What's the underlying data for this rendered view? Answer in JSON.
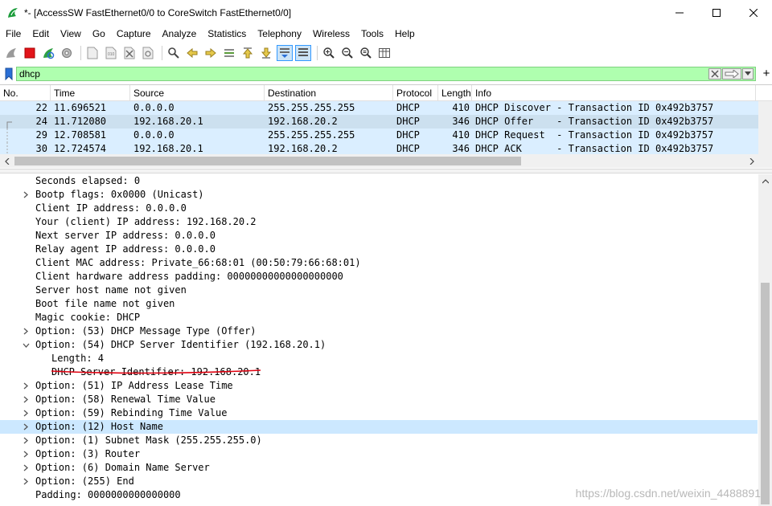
{
  "window": {
    "title": "*- [AccessSW FastEthernet0/0 to CoreSwitch FastEthernet0/0]",
    "minimize": "—",
    "maximize": "☐",
    "close": "✕"
  },
  "menu": [
    "File",
    "Edit",
    "View",
    "Go",
    "Capture",
    "Analyze",
    "Statistics",
    "Telephony",
    "Wireless",
    "Tools",
    "Help"
  ],
  "filter": {
    "value": "dhcp",
    "add": "+"
  },
  "packet_list": {
    "columns": [
      "No.",
      "Time",
      "Source",
      "Destination",
      "Protocol",
      "Length",
      "Info"
    ],
    "rows": [
      {
        "no": "22",
        "time": "11.696521",
        "src": "0.0.0.0",
        "dst": "255.255.255.255",
        "proto": "DHCP",
        "len": "410",
        "info": "DHCP Discover - Transaction ID 0x492b3757"
      },
      {
        "no": "24",
        "time": "11.712080",
        "src": "192.168.20.1",
        "dst": "192.168.20.2",
        "proto": "DHCP",
        "len": "346",
        "info": "DHCP Offer    - Transaction ID 0x492b3757"
      },
      {
        "no": "29",
        "time": "12.708581",
        "src": "0.0.0.0",
        "dst": "255.255.255.255",
        "proto": "DHCP",
        "len": "410",
        "info": "DHCP Request  - Transaction ID 0x492b3757"
      },
      {
        "no": "30",
        "time": "12.724574",
        "src": "192.168.20.1",
        "dst": "192.168.20.2",
        "proto": "DHCP",
        "len": "346",
        "info": "DHCP ACK      - Transaction ID 0x492b3757"
      }
    ]
  },
  "details": [
    {
      "text": "Seconds elapsed: 0",
      "indent": 0,
      "arrow": "none"
    },
    {
      "text": "Bootp flags: 0x0000 (Unicast)",
      "indent": 0,
      "arrow": "right"
    },
    {
      "text": "Client IP address: 0.0.0.0",
      "indent": 0,
      "arrow": "none"
    },
    {
      "text": "Your (client) IP address: 192.168.20.2",
      "indent": 0,
      "arrow": "none"
    },
    {
      "text": "Next server IP address: 0.0.0.0",
      "indent": 0,
      "arrow": "none"
    },
    {
      "text": "Relay agent IP address: 0.0.0.0",
      "indent": 0,
      "arrow": "none"
    },
    {
      "text": "Client MAC address: Private_66:68:01 (00:50:79:66:68:01)",
      "indent": 0,
      "arrow": "none"
    },
    {
      "text": "Client hardware address padding: 00000000000000000000",
      "indent": 0,
      "arrow": "none"
    },
    {
      "text": "Server host name not given",
      "indent": 0,
      "arrow": "none"
    },
    {
      "text": "Boot file name not given",
      "indent": 0,
      "arrow": "none"
    },
    {
      "text": "Magic cookie: DHCP",
      "indent": 0,
      "arrow": "none"
    },
    {
      "text": "Option: (53) DHCP Message Type (Offer)",
      "indent": 0,
      "arrow": "right"
    },
    {
      "text": "Option: (54) DHCP Server Identifier (192.168.20.1)",
      "indent": 0,
      "arrow": "down"
    },
    {
      "text": "Length: 4",
      "indent": 1,
      "arrow": "none"
    },
    {
      "text": "DHCP Server Identifier: 192.168.20.1",
      "indent": 1,
      "arrow": "none"
    },
    {
      "text": "Option: (51) IP Address Lease Time",
      "indent": 0,
      "arrow": "right"
    },
    {
      "text": "Option: (58) Renewal Time Value",
      "indent": 0,
      "arrow": "right"
    },
    {
      "text": "Option: (59) Rebinding Time Value",
      "indent": 0,
      "arrow": "right"
    },
    {
      "text": "Option: (12) Host Name",
      "indent": 0,
      "arrow": "right",
      "selected": true
    },
    {
      "text": "Option: (1) Subnet Mask (255.255.255.0)",
      "indent": 0,
      "arrow": "right"
    },
    {
      "text": "Option: (3) Router",
      "indent": 0,
      "arrow": "right"
    },
    {
      "text": "Option: (6) Domain Name Server",
      "indent": 0,
      "arrow": "right"
    },
    {
      "text": "Option: (255) End",
      "indent": 0,
      "arrow": "right"
    },
    {
      "text": "Padding: 0000000000000000",
      "indent": 0,
      "arrow": "none"
    }
  ],
  "watermark": "https://blog.csdn.net/weixin_4488891",
  "colors": {
    "filter_bg": "#afffaf",
    "row_highlight": "#daeeff",
    "row_selected": "#cce0ef",
    "detail_selected": "#cce8ff",
    "annotation": "#e0000f"
  }
}
